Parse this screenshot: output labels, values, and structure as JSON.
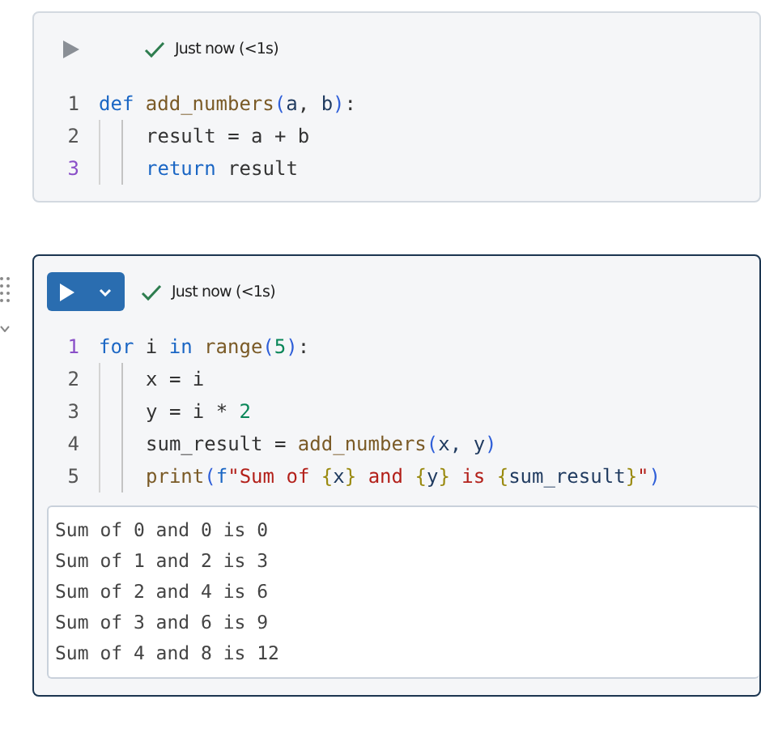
{
  "cells": [
    {
      "selected": false,
      "run_button": {
        "kind": "icon"
      },
      "status": {
        "text": "Just now (<1s)"
      },
      "code": [
        {
          "number": "1",
          "current": false,
          "indented": false,
          "tokens": [
            {
              "text": "def ",
              "kind": "keyword"
            },
            {
              "text": "add_numbers",
              "kind": "function"
            },
            {
              "text": "(",
              "kind": "bracket"
            },
            {
              "text": "a",
              "kind": "param"
            },
            {
              "text": ", ",
              "kind": "plain"
            },
            {
              "text": "b",
              "kind": "param"
            },
            {
              "text": ")",
              "kind": "bracket"
            },
            {
              "text": ":",
              "kind": "plain"
            }
          ]
        },
        {
          "number": "2",
          "current": false,
          "indented": true,
          "tokens": [
            {
              "text": "result = a + b",
              "kind": "plain"
            }
          ]
        },
        {
          "number": "3",
          "current": true,
          "indented": true,
          "tokens": [
            {
              "text": "return ",
              "kind": "keyword"
            },
            {
              "text": "result",
              "kind": "plain"
            }
          ]
        }
      ]
    },
    {
      "selected": true,
      "run_button": {
        "kind": "split"
      },
      "status": {
        "text": "Just now (<1s)"
      },
      "code": [
        {
          "number": "1",
          "current": true,
          "indented": false,
          "tokens": [
            {
              "text": "for ",
              "kind": "keyword"
            },
            {
              "text": "i ",
              "kind": "plain"
            },
            {
              "text": "in ",
              "kind": "keyword"
            },
            {
              "text": "range",
              "kind": "function"
            },
            {
              "text": "(",
              "kind": "bracket"
            },
            {
              "text": "5",
              "kind": "number"
            },
            {
              "text": ")",
              "kind": "bracket"
            },
            {
              "text": ":",
              "kind": "plain"
            }
          ]
        },
        {
          "number": "2",
          "current": false,
          "indented": true,
          "tokens": [
            {
              "text": "x = i",
              "kind": "plain"
            }
          ]
        },
        {
          "number": "3",
          "current": false,
          "indented": true,
          "tokens": [
            {
              "text": "y = i * ",
              "kind": "plain"
            },
            {
              "text": "2",
              "kind": "number"
            }
          ]
        },
        {
          "number": "4",
          "current": false,
          "indented": true,
          "tokens": [
            {
              "text": "sum_result = ",
              "kind": "plain"
            },
            {
              "text": "add_numbers",
              "kind": "function"
            },
            {
              "text": "(",
              "kind": "bracket"
            },
            {
              "text": "x, y",
              "kind": "param"
            },
            {
              "text": ")",
              "kind": "bracket"
            }
          ]
        },
        {
          "number": "5",
          "current": false,
          "indented": true,
          "tokens": [
            {
              "text": "print",
              "kind": "function"
            },
            {
              "text": "(",
              "kind": "bracket"
            },
            {
              "text": "f",
              "kind": "keyword"
            },
            {
              "text": "\"Sum of ",
              "kind": "string"
            },
            {
              "text": "{",
              "kind": "brace"
            },
            {
              "text": "x",
              "kind": "param"
            },
            {
              "text": "}",
              "kind": "brace"
            },
            {
              "text": " and ",
              "kind": "string"
            },
            {
              "text": "{",
              "kind": "brace"
            },
            {
              "text": "y",
              "kind": "param"
            },
            {
              "text": "}",
              "kind": "brace"
            },
            {
              "text": " is ",
              "kind": "string"
            },
            {
              "text": "{",
              "kind": "brace"
            },
            {
              "text": "sum_result",
              "kind": "param"
            },
            {
              "text": "}",
              "kind": "brace"
            },
            {
              "text": "\"",
              "kind": "string"
            },
            {
              "text": ")",
              "kind": "bracket"
            }
          ]
        }
      ],
      "output": [
        "Sum of 0 and 0 is 0",
        "Sum of 1 and 2 is 3",
        "Sum of 2 and 4 is 6",
        "Sum of 3 and 6 is 9",
        "Sum of 4 and 8 is 12"
      ]
    }
  ]
}
